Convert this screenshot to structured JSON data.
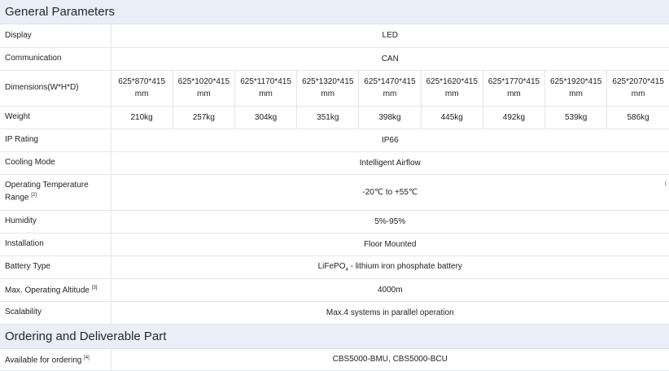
{
  "general": {
    "title": "General Parameters",
    "display": {
      "label": "Display",
      "value": "LED"
    },
    "communication": {
      "label": "Communication",
      "value": "CAN"
    },
    "dimensions": {
      "label": "Dimensions(W*H*D)",
      "values": [
        {
          "top": "625*870*415",
          "bottom": "mm"
        },
        {
          "top": "625*1020*415",
          "bottom": "mm"
        },
        {
          "top": "625*1170*415",
          "bottom": "mm"
        },
        {
          "top": "625*1320*415",
          "bottom": "mm"
        },
        {
          "top": "625*1470*415",
          "bottom": "mm"
        },
        {
          "top": "625*1620*415",
          "bottom": "mm"
        },
        {
          "top": "625*1770*415",
          "bottom": "mm"
        },
        {
          "top": "625*1920*415",
          "bottom": "mm"
        },
        {
          "top": "625*2070*415",
          "bottom": "mm"
        }
      ]
    },
    "weight": {
      "label": "Weight",
      "values": [
        "210kg",
        "257kg",
        "304kg",
        "351kg",
        "398kg",
        "445kg",
        "492kg",
        "539kg",
        "586kg"
      ]
    },
    "ip": {
      "label": "IP Rating",
      "value": "IP66"
    },
    "cooling": {
      "label": "Cooling Mode",
      "value": "Intelligent Airflow"
    },
    "temperature": {
      "label_line1": "Operating Temperature",
      "label_line2": "Range",
      "note": "[2]",
      "value": "-20℃ to +55℃"
    },
    "humidity": {
      "label": "Humidity",
      "value": "5%-95%"
    },
    "installation": {
      "label": "Installation",
      "value": "Floor Mounted"
    },
    "battery": {
      "label": "Battery Type",
      "value_pre": "LiFePO",
      "value_sub": "4",
      "value_post": " - lithium iron phosphate battery"
    },
    "altitude": {
      "label": "Max. Operating Altitude",
      "note": "[3]",
      "value": "4000m"
    },
    "scalability": {
      "label": "Scalability",
      "value": "Max.4 systems in parallel operation"
    }
  },
  "ordering": {
    "title": "Ordering and Deliverable Part",
    "available": {
      "label": "Available for ordering",
      "note": "[4]",
      "value": "CBS5000-BMU, CBS5000-BCU"
    }
  }
}
